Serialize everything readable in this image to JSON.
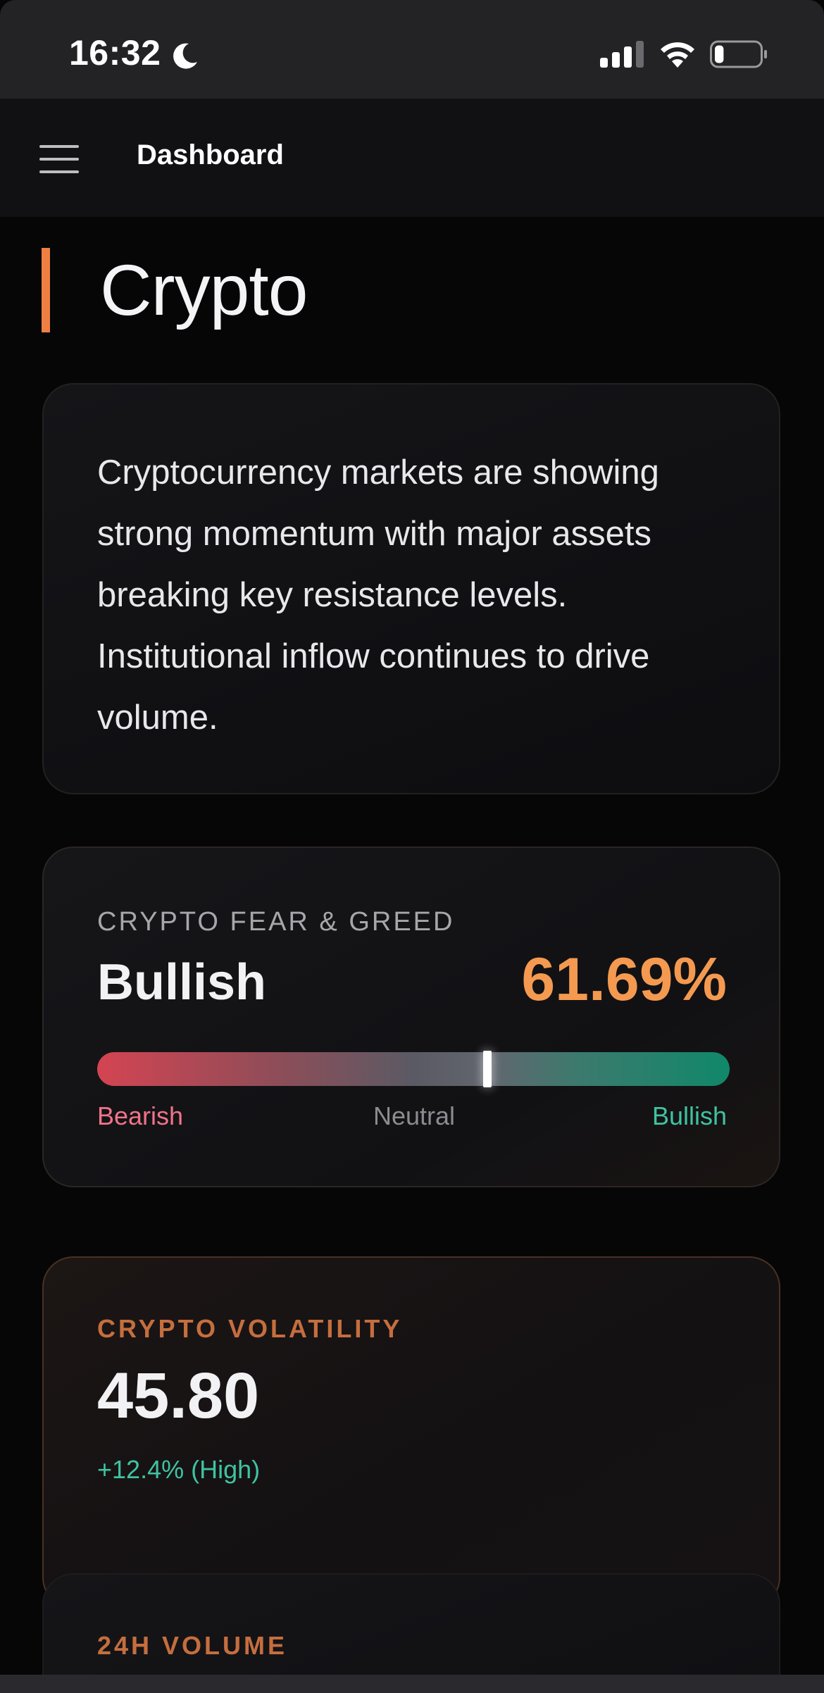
{
  "status_bar": {
    "time": "16:32",
    "icons": [
      "moon-icon",
      "signal-icon",
      "wifi-icon",
      "battery-icon"
    ],
    "battery_level": 0.2
  },
  "nav": {
    "title": "Dashboard",
    "menu_icon": "hamburger-menu-icon"
  },
  "page": {
    "title": "Crypto",
    "accent_color": "#ee7f43"
  },
  "summary": {
    "text": "Cryptocurrency markets are showing strong momentum with major assets breaking key resistance levels. Institutional inflow continues to drive volume."
  },
  "fear_greed": {
    "label": "CRYPTO FEAR & GREED",
    "state": "Bullish",
    "value": "61.69%",
    "value_number": 61.69,
    "scale": {
      "min_label": "Bearish",
      "mid_label": "Neutral",
      "max_label": "Bullish"
    },
    "colors": {
      "value": "#f49a50",
      "bearish": "#f0748a",
      "bullish": "#3fc3a1"
    }
  },
  "volatility": {
    "label": "CRYPTO VOLATILITY",
    "value": "45.80",
    "change": "+12.4% (High)",
    "change_color": "#3fc3a1"
  },
  "volume": {
    "label": "24H VOLUME"
  }
}
